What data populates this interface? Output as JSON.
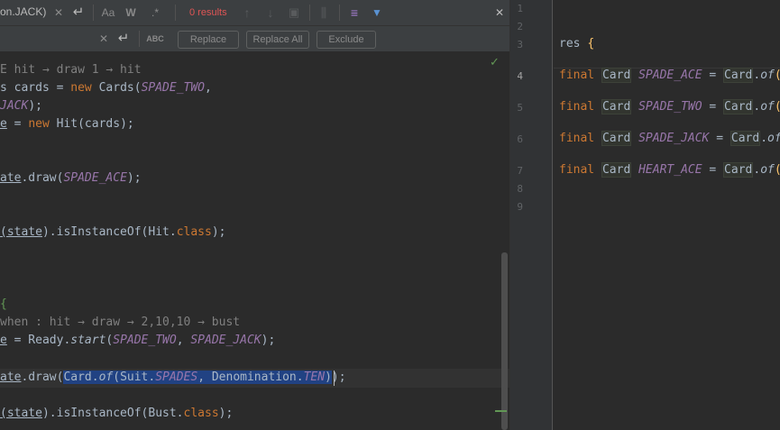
{
  "find_bar": {
    "search_text": "on.JACK)",
    "results_text": "0 results",
    "icons": [
      "clear-icon",
      "new-line-icon",
      "match-case-icon",
      "whole-words-icon",
      "regex-icon",
      "prev-occurrence-icon",
      "next-occurrence-icon",
      "select-all-icon",
      "filter-context-icon",
      "filter-icon",
      "close-icon"
    ],
    "glyphs": {
      "clear": "✕",
      "newline": "↵",
      "match_case": "Aa",
      "words": "W",
      "regex": ".*",
      "prev": "↑",
      "next": "↓",
      "select_all": "▣",
      "context": "⫼",
      "multi": "≡",
      "filter": "▼",
      "close": "✕"
    }
  },
  "replace_bar": {
    "clear_glyph": "✕",
    "newline_glyph": "↵",
    "preserve_case_label": "ABC",
    "replace_label": "Replace",
    "replace_all_label": "Replace All",
    "exclude_label": "Exclude"
  },
  "left_code": {
    "check_glyph": "✓",
    "lines": [
      {
        "t1": "E hit → draw 1 → hit"
      },
      {
        "t1": "s cards = ",
        "kw": "new",
        "t2": " Cards(",
        "it": "SPADE_TWO",
        "t3": ","
      },
      {
        "it": "JACK",
        "t1": ");"
      },
      {
        "ul": "e",
        "t1": " = ",
        "kw": "new",
        "t2": " Hit(cards);"
      },
      {
        "ul": "ate",
        "t1": ".draw(",
        "it": "SPADE_ACE",
        "t2": ");"
      },
      {
        "ul": "(state",
        "t1": ").isInstanceOf(Hit.",
        "kw": "class",
        "t2": ");"
      },
      {
        "t1": "{"
      },
      {
        "t1": "when : hit → draw → 2,10,10 → bust"
      },
      {
        "ul": "e",
        "t1": " = Ready.",
        "fn": "start",
        "t2": "(",
        "it1": "SPADE_TWO",
        "t3": ", ",
        "it2": "SPADE_JACK",
        "t4": ");"
      },
      {
        "ul": "ate",
        "t1": ".draw(",
        "hl1": "Card.",
        "hl_fn": "of",
        "hl2": "(Suit.",
        "hl_it1": "SPADES",
        "hl3": ", Denomination.",
        "hl_it2": "TEN",
        "hl4": ")",
        "t2": ");"
      },
      {
        "ul": "(state",
        "t1": ").isInstanceOf(Bust.",
        "kw": "class",
        "t2": ");"
      }
    ]
  },
  "right_pane": {
    "line_numbers": [
      "1",
      "2",
      "3",
      "4",
      "5",
      "6",
      "7",
      "8",
      "9"
    ],
    "res_line": {
      "t": "res ",
      "brace": "{"
    },
    "decls": [
      {
        "kw": "final",
        "type": "Card",
        "name": "SPADE_ACE",
        "eq": " = ",
        "cls": "Card",
        "dot": ".",
        "fn": "of",
        "paren": "("
      },
      {
        "kw": "final",
        "type": "Card",
        "name": "SPADE_TWO",
        "eq": " = ",
        "cls": "Card",
        "dot": ".",
        "fn": "of",
        "paren": "("
      },
      {
        "kw": "final",
        "type": "Card",
        "name": "SPADE_JACK",
        "eq": " = ",
        "cls": "Card",
        "dot": ".",
        "fn": "of",
        "paren": "("
      },
      {
        "kw": "final",
        "type": "Card",
        "name": "HEART_ACE",
        "eq": " = ",
        "cls": "Card",
        "dot": ".",
        "fn": "of",
        "paren": "("
      }
    ]
  },
  "colors": {
    "background": "#2b2b2b",
    "toolbar": "#3c3f41",
    "keyword": "#cc7832",
    "constant": "#9876aa",
    "text": "#a9b7c6",
    "comment": "#808080",
    "selection": "#214283",
    "results": "#e05555",
    "filter_accent": "#5a93d4",
    "ok_green": "#629755"
  }
}
